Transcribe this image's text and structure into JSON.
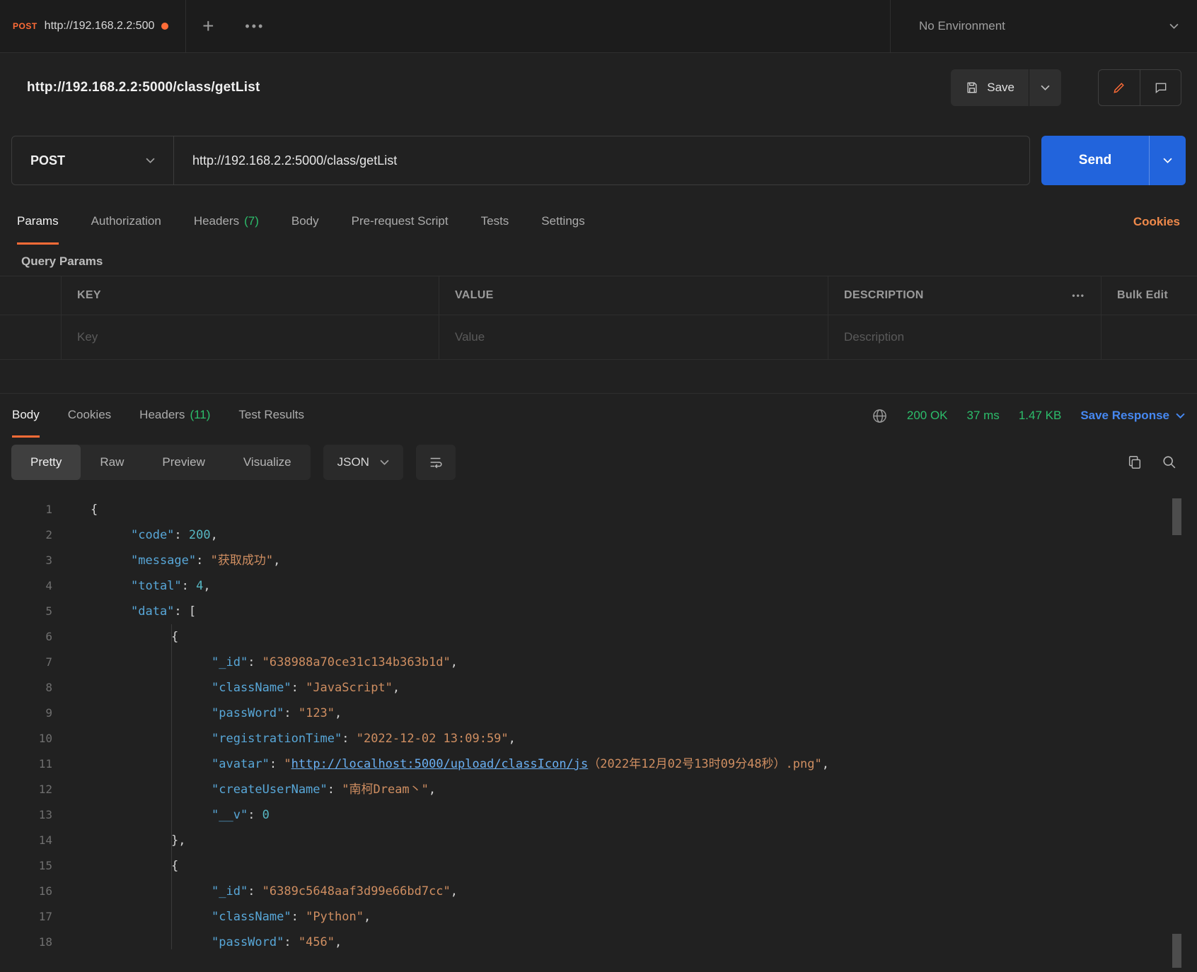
{
  "colors": {
    "accent_orange": "#ff6c37",
    "success_green": "#2cbd6b",
    "link_blue": "#4688f1",
    "send_blue": "#2264dc"
  },
  "topbar": {
    "tab_method": "POST",
    "tab_url": "http://192.168.2.2:500",
    "environment": "No Environment"
  },
  "request": {
    "title": "http://192.168.2.2:5000/class/getList",
    "save_label": "Save",
    "method": "POST",
    "url": "http://192.168.2.2:5000/class/getList",
    "send_label": "Send",
    "tabs": [
      {
        "label": "Params",
        "active": true
      },
      {
        "label": "Authorization",
        "active": false
      },
      {
        "label": "Headers",
        "count": "(7)",
        "active": false
      },
      {
        "label": "Body",
        "active": false
      },
      {
        "label": "Pre-request Script",
        "active": false
      },
      {
        "label": "Tests",
        "active": false
      },
      {
        "label": "Settings",
        "active": false
      }
    ],
    "cookies_link": "Cookies",
    "query_params": {
      "title": "Query Params",
      "columns": [
        "KEY",
        "VALUE",
        "DESCRIPTION"
      ],
      "more_icon": "•••",
      "bulk_edit_label": "Bulk Edit",
      "placeholders": {
        "key": "Key",
        "value": "Value",
        "description": "Description"
      }
    }
  },
  "response": {
    "tabs": [
      {
        "label": "Body",
        "active": true
      },
      {
        "label": "Cookies",
        "active": false
      },
      {
        "label": "Headers",
        "count": "(11)",
        "active": false
      },
      {
        "label": "Test Results",
        "active": false
      }
    ],
    "status": "200 OK",
    "time": "37 ms",
    "size": "1.47 KB",
    "save_response_label": "Save Response",
    "view_modes": [
      {
        "label": "Pretty",
        "active": true
      },
      {
        "label": "Raw",
        "active": false
      },
      {
        "label": "Preview",
        "active": false
      },
      {
        "label": "Visualize",
        "active": false
      }
    ],
    "format": "JSON",
    "body_lines": [
      {
        "n": 1,
        "indent": 0,
        "tokens": [
          {
            "t": "punct",
            "v": "{"
          }
        ]
      },
      {
        "n": 2,
        "indent": 1,
        "tokens": [
          {
            "t": "key",
            "v": "\"code\""
          },
          {
            "t": "punct",
            "v": ": "
          },
          {
            "t": "num",
            "v": "200"
          },
          {
            "t": "punct",
            "v": ","
          }
        ]
      },
      {
        "n": 3,
        "indent": 1,
        "tokens": [
          {
            "t": "key",
            "v": "\"message\""
          },
          {
            "t": "punct",
            "v": ": "
          },
          {
            "t": "str",
            "v": "\"获取成功\""
          },
          {
            "t": "punct",
            "v": ","
          }
        ]
      },
      {
        "n": 4,
        "indent": 1,
        "tokens": [
          {
            "t": "key",
            "v": "\"total\""
          },
          {
            "t": "punct",
            "v": ": "
          },
          {
            "t": "num",
            "v": "4"
          },
          {
            "t": "punct",
            "v": ","
          }
        ]
      },
      {
        "n": 5,
        "indent": 1,
        "tokens": [
          {
            "t": "key",
            "v": "\"data\""
          },
          {
            "t": "punct",
            "v": ": ["
          }
        ]
      },
      {
        "n": 6,
        "indent": 2,
        "tokens": [
          {
            "t": "punct",
            "v": "{"
          }
        ]
      },
      {
        "n": 7,
        "indent": 3,
        "tokens": [
          {
            "t": "key",
            "v": "\"_id\""
          },
          {
            "t": "punct",
            "v": ": "
          },
          {
            "t": "str",
            "v": "\"638988a70ce31c134b363b1d\""
          },
          {
            "t": "punct",
            "v": ","
          }
        ]
      },
      {
        "n": 8,
        "indent": 3,
        "tokens": [
          {
            "t": "key",
            "v": "\"className\""
          },
          {
            "t": "punct",
            "v": ": "
          },
          {
            "t": "str",
            "v": "\"JavaScript\""
          },
          {
            "t": "punct",
            "v": ","
          }
        ]
      },
      {
        "n": 9,
        "indent": 3,
        "tokens": [
          {
            "t": "key",
            "v": "\"passWord\""
          },
          {
            "t": "punct",
            "v": ": "
          },
          {
            "t": "str",
            "v": "\"123\""
          },
          {
            "t": "punct",
            "v": ","
          }
        ]
      },
      {
        "n": 10,
        "indent": 3,
        "tokens": [
          {
            "t": "key",
            "v": "\"registrationTime\""
          },
          {
            "t": "punct",
            "v": ": "
          },
          {
            "t": "str",
            "v": "\"2022-12-02 13:09:59\""
          },
          {
            "t": "punct",
            "v": ","
          }
        ]
      },
      {
        "n": 11,
        "indent": 3,
        "tokens": [
          {
            "t": "key",
            "v": "\"avatar\""
          },
          {
            "t": "punct",
            "v": ": "
          },
          {
            "t": "str",
            "v": "\""
          },
          {
            "t": "link",
            "v": "http://localhost:5000/upload/classIcon/js"
          },
          {
            "t": "str",
            "v": "（2022年12月02号13时09分48秒）.png\""
          },
          {
            "t": "punct",
            "v": ","
          }
        ]
      },
      {
        "n": 12,
        "indent": 3,
        "tokens": [
          {
            "t": "key",
            "v": "\"createUserName\""
          },
          {
            "t": "punct",
            "v": ": "
          },
          {
            "t": "str",
            "v": "\"南柯Dream丶\""
          },
          {
            "t": "punct",
            "v": ","
          }
        ]
      },
      {
        "n": 13,
        "indent": 3,
        "tokens": [
          {
            "t": "key",
            "v": "\"__v\""
          },
          {
            "t": "punct",
            "v": ": "
          },
          {
            "t": "num",
            "v": "0"
          }
        ]
      },
      {
        "n": 14,
        "indent": 2,
        "tokens": [
          {
            "t": "punct",
            "v": "},"
          }
        ]
      },
      {
        "n": 15,
        "indent": 2,
        "tokens": [
          {
            "t": "punct",
            "v": "{"
          }
        ]
      },
      {
        "n": 16,
        "indent": 3,
        "tokens": [
          {
            "t": "key",
            "v": "\"_id\""
          },
          {
            "t": "punct",
            "v": ": "
          },
          {
            "t": "str",
            "v": "\"6389c5648aaf3d99e66bd7cc\""
          },
          {
            "t": "punct",
            "v": ","
          }
        ]
      },
      {
        "n": 17,
        "indent": 3,
        "tokens": [
          {
            "t": "key",
            "v": "\"className\""
          },
          {
            "t": "punct",
            "v": ": "
          },
          {
            "t": "str",
            "v": "\"Python\""
          },
          {
            "t": "punct",
            "v": ","
          }
        ]
      },
      {
        "n": 18,
        "indent": 3,
        "tokens": [
          {
            "t": "key",
            "v": "\"passWord\""
          },
          {
            "t": "punct",
            "v": ": "
          },
          {
            "t": "str",
            "v": "\"456\""
          },
          {
            "t": "punct",
            "v": ","
          }
        ]
      }
    ]
  }
}
